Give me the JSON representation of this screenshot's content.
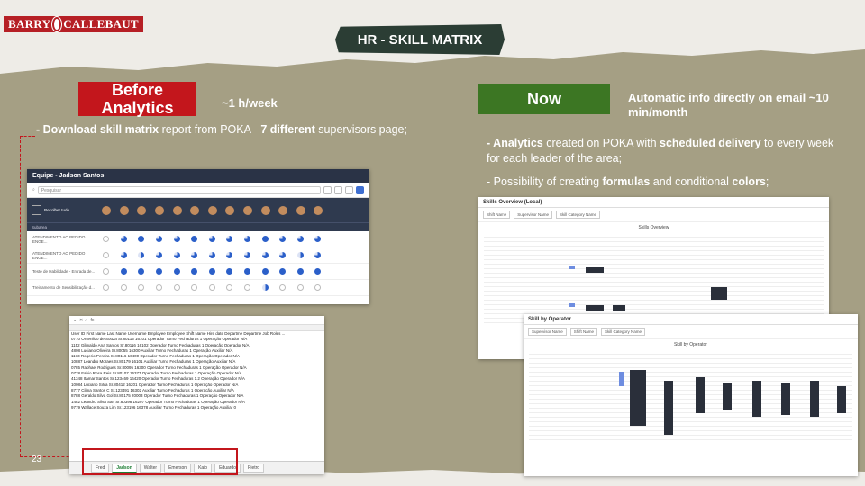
{
  "header": {
    "logo_text": "BARRY CALLEBAUT",
    "title": "HR - SKILL MATRIX"
  },
  "before": {
    "badge": "Before Analytics",
    "time": "~1 h/week",
    "text_bold1": "- Download skill matrix",
    "text_normal1": " report from POKA - ",
    "text_bold2": "7 different",
    "text_normal2": " supervisors page;"
  },
  "now": {
    "badge": "Now",
    "time": "Automatic info directly on email ~10 min/month",
    "line1_bold1": "- Analytics",
    "line1_normal1": " created on POKA with ",
    "line1_bold2": "scheduled delivery",
    "line1_normal2": " to every week for each leader of the area;",
    "line2_normal1": "- Possibility of creating ",
    "line2_bold1": "formulas",
    "line2_normal2": " and conditional ",
    "line2_bold2": "colors",
    "line2_normal3": ";"
  },
  "page_number": "23",
  "equipe_shot": {
    "title": "Equipe - Jadson Santos",
    "search_placeholder": "Pesquisar",
    "team_label": "Recolher tudo",
    "sub_label": "Subarea",
    "rows": [
      "ATENDIMENTO AO PEDIDO ENGE...",
      "ATENDIMENTO AO PEDIDO ENGE...",
      "Teste de Habilidade - Entrada de...",
      "Treinamento de Sensibilização d..."
    ]
  },
  "excel_shot": {
    "header_row": "User ID  First Name  Last Name  Username  Employee  Employee Shift Name  Hire date  Departme  Departme  Job Roles  ...",
    "rows": [
      "0770 Orsenildo de Souza  Sr.80115  16101  Operador Turno Fechaduras  1  Operação  Operador  N/A",
      "1152 Gilmaldo  Ana Santos  Sr.80116  16102  Operador Turno Fechaduras  1  Operação  Operador  N/A",
      "4808 Luciano  Oliveira  Sr.80055  16300  Auxiliar Turno Fechaduras  1  Operação  Auxiliar  N/A",
      "1173 Rogerio  Pereira  Sr.80116  16400  Operador Turno Fechaduras  1  Operação  Operador  N/A",
      "10887 Leandro  Moraes  Sr.80179  16101  Auxiliar Turno Fechaduras  1  Operação  Auxiliar  N/A",
      "0785 Raphael  Rodrigues  Sr.80095  16300  Operador Turno Fechaduras  1  Operação  Operador  N/A",
      "0778 Fabio  Rosa Reis  Sr.80107  16377  Operador Turno Fechaduras  1  Operação  Operador  N/A",
      "41348 Itamar  Santos  Sr.123469  16420  Operador Turno Fechaduras  1.2  Operação  Operador  N/A",
      "10084 Luciano  Silva  Sr.80412  16201  Operador Turno Fechaduras  1  Operação  Operador  N/A",
      "8777 Cilma  Santos C  Sr.123491  16302  Auxiliar Turno Fechaduras  1  Operação  Auxiliar  N/A",
      "8788 Geraldo  Silva Gol  Sr.80175  20003  Operador Turno Fechaduras  1  Operação  Operador  N/A",
      "1482 Leandro  Silva San  Sr.80398  16207  Operador Turno Fechaduras  1  Operação  Operador  N/A",
      "9779 Wallace  Souza Lim  Sr.123196  16378  Auxiliar Turno Fechaduras  1  Operação  Auxiliar  0"
    ],
    "tabs": [
      "Fred",
      "Jadson",
      "Walter",
      "Emerson",
      "Kaio",
      "Eduardo",
      "Pietro"
    ]
  },
  "skills_overview": {
    "title": "Skills Overview (Local)",
    "filters": [
      "Shift Name",
      "Supervisor Name",
      "Skill Category Name"
    ],
    "subtitle": "Skills Overview"
  },
  "skill_by_operator": {
    "title": "Skill by Operator",
    "filters": [
      "Supervisor Name",
      "Shift Name",
      "Skill Category Name"
    ],
    "subtitle": "Skill by Operator"
  }
}
